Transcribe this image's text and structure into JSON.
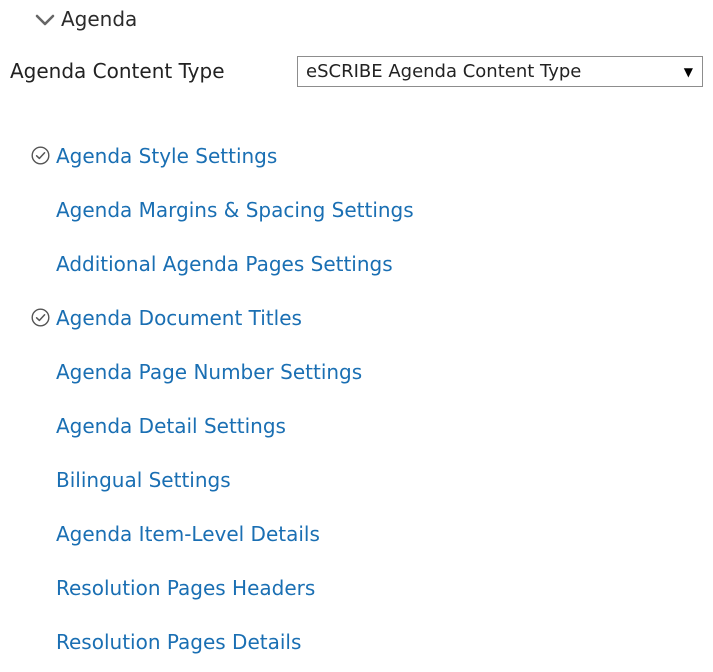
{
  "section": {
    "title": "Agenda",
    "icon": "chevron-down-icon"
  },
  "content_type": {
    "label": "Agenda Content Type",
    "selected": "eSCRIBE Agenda Content Type"
  },
  "links": [
    {
      "label": "Agenda Style Settings",
      "checked": true
    },
    {
      "label": "Agenda Margins & Spacing Settings",
      "checked": false
    },
    {
      "label": "Additional Agenda Pages Settings",
      "checked": false
    },
    {
      "label": "Agenda Document Titles",
      "checked": true
    },
    {
      "label": "Agenda Page Number Settings",
      "checked": false
    },
    {
      "label": "Agenda Detail Settings",
      "checked": false
    },
    {
      "label": "Bilingual Settings",
      "checked": false
    },
    {
      "label": "Agenda Item-Level Details",
      "checked": false
    },
    {
      "label": "Resolution Pages Headers",
      "checked": false
    },
    {
      "label": "Resolution Pages Details",
      "checked": false
    }
  ],
  "colors": {
    "link": "#1a6fb3",
    "text": "#222222",
    "icon": "#555555"
  }
}
